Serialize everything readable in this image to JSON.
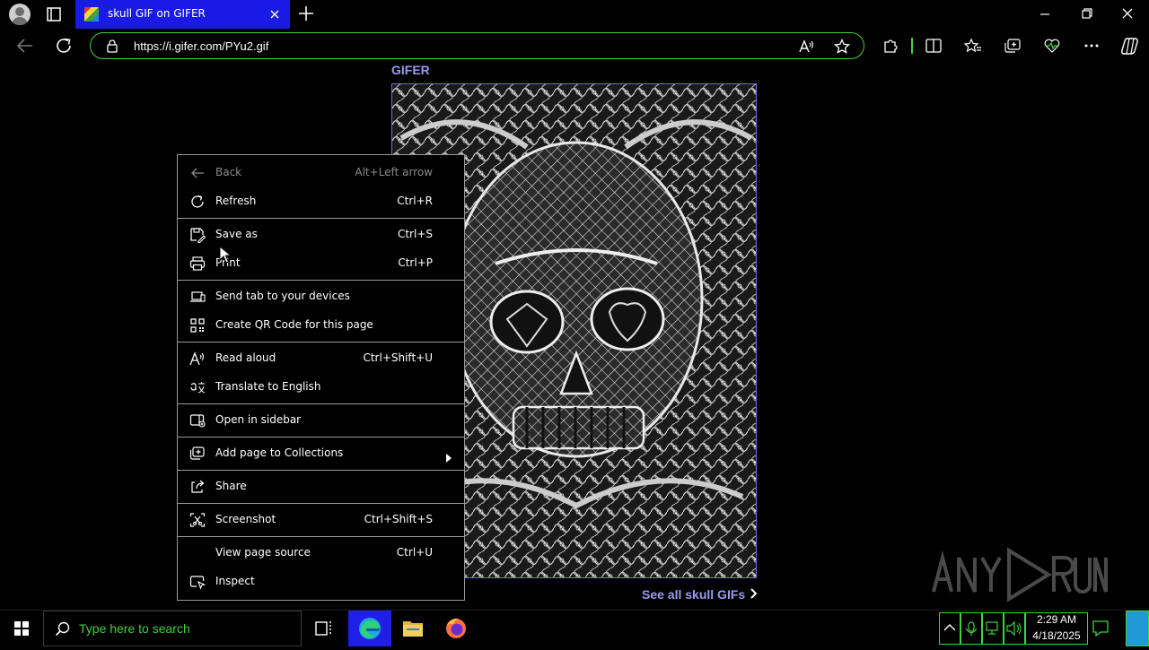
{
  "browser": {
    "tab_title": "skull GIF on GIFER",
    "url": "https://i.gifer.com/PYu2.gif"
  },
  "page": {
    "site_name": "GIFER",
    "see_all_link": "See all skull GIFs",
    "gif_alt": "skull GIF",
    "watermark": "ANY RUN"
  },
  "context_menu": {
    "items": [
      {
        "label": "Back",
        "shortcut": "Alt+Left arrow",
        "icon": "back-arrow-icon",
        "disabled": true
      },
      {
        "label": "Refresh",
        "shortcut": "Ctrl+R",
        "icon": "refresh-icon"
      },
      {
        "label": "Save as",
        "shortcut": "Ctrl+S",
        "icon": "save-as-icon"
      },
      {
        "label": "Print",
        "shortcut": "Ctrl+P",
        "icon": "printer-icon"
      },
      {
        "label": "Send tab to your devices",
        "shortcut": "",
        "icon": "devices-icon"
      },
      {
        "label": "Create QR Code for this page",
        "shortcut": "",
        "icon": "qr-code-icon"
      },
      {
        "label": "Read aloud",
        "shortcut": "Ctrl+Shift+U",
        "icon": "read-aloud-icon"
      },
      {
        "label": "Translate to English",
        "shortcut": "",
        "icon": "translate-icon"
      },
      {
        "label": "Open in sidebar",
        "shortcut": "",
        "icon": "sidebar-icon"
      },
      {
        "label": "Add page to Collections",
        "shortcut": "",
        "icon": "collections-icon",
        "submenu": true
      },
      {
        "label": "Share",
        "shortcut": "",
        "icon": "share-icon"
      },
      {
        "label": "Screenshot",
        "shortcut": "Ctrl+Shift+S",
        "icon": "screenshot-icon"
      },
      {
        "label": "View page source",
        "shortcut": "Ctrl+U",
        "icon": ""
      },
      {
        "label": "Inspect",
        "shortcut": "",
        "icon": "inspect-icon"
      }
    ]
  },
  "taskbar": {
    "search_placeholder": "Type here to search",
    "time": "2:29 AM",
    "date": "4/18/2025"
  },
  "colors": {
    "accent_green": "#3fd23f",
    "tab_blue": "#1a1ae6",
    "link_purple": "#9a9af0"
  }
}
